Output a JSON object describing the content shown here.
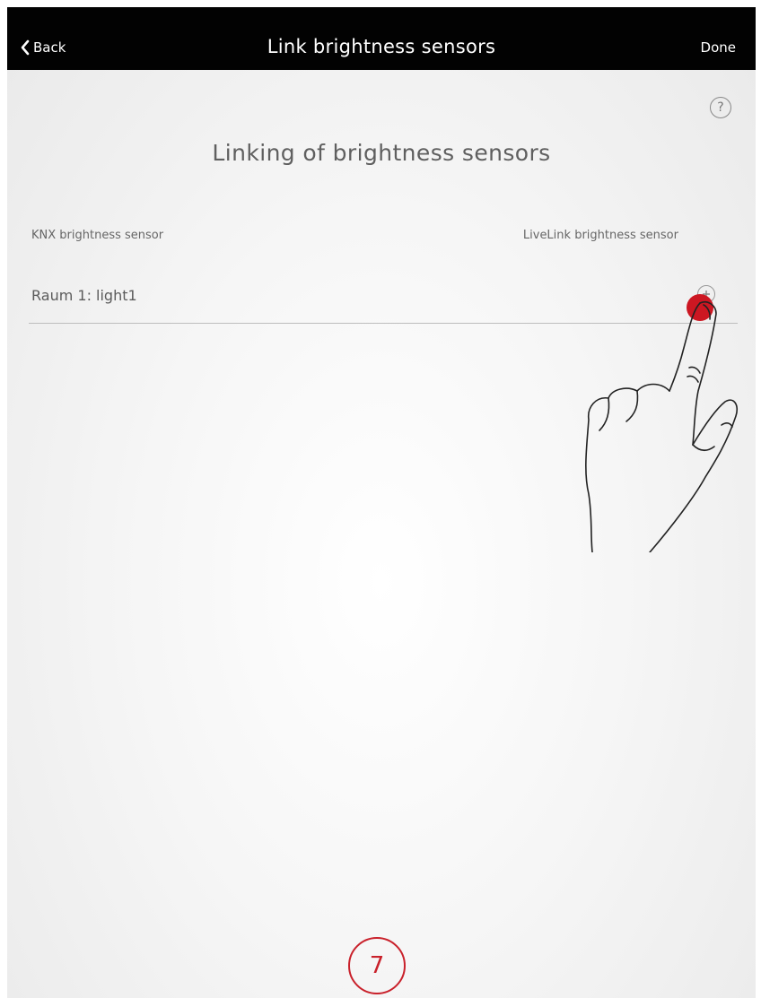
{
  "nav": {
    "back_label": "Back",
    "title": "Link brightness sensors",
    "done_label": "Done"
  },
  "help": {
    "symbol": "?"
  },
  "page": {
    "heading": "Linking of brightness sensors"
  },
  "columns": {
    "knx": "KNX brightness sensor",
    "livelink": "LiveLink brightness sensor"
  },
  "rows": [
    {
      "label": "Raum 1: light1"
    }
  ],
  "step_badge": {
    "number": "7"
  },
  "colors": {
    "navbar": "#020202",
    "accent": "#c9212b",
    "tap_indicator": "#cc1722"
  },
  "icons": {
    "back": "chevron-left-icon",
    "help": "question-circle-icon",
    "row_action": "add-circle-icon"
  }
}
